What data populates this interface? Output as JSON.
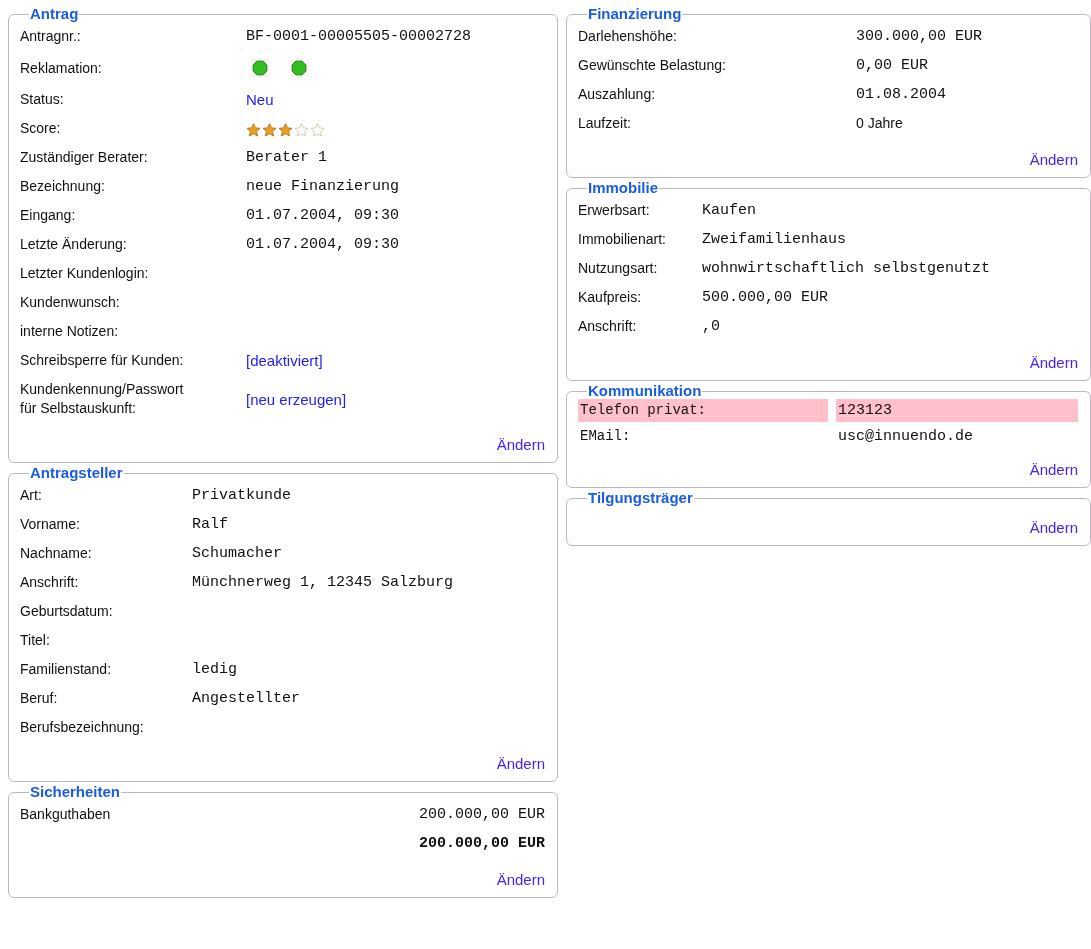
{
  "columns": [
    {
      "sections": [
        {
          "title": "Antrag",
          "kind": "grid",
          "rows": [
            {
              "label": "Antragnr.:",
              "kind": "mono",
              "value": "BF-0001-00005505-00002728"
            },
            {
              "label": "Reklamation:",
              "kind": "dots",
              "dots": [
                {
                  "color": "#33bb22"
                },
                {
                  "color": "#33bb22"
                }
              ]
            },
            {
              "label": "Status:",
              "kind": "link",
              "value": "Neu"
            },
            {
              "label": "Score:",
              "kind": "stars",
              "stars": 3
            },
            {
              "label": "Zuständiger Berater:",
              "kind": "mono",
              "value": "Berater 1"
            },
            {
              "label": "Bezeichnung:",
              "kind": "mono",
              "value": "neue Finanzierung"
            },
            {
              "label": "Eingang:",
              "kind": "mono",
              "value": "01.07.2004, 09:30"
            },
            {
              "label": "Letzte Änderung:",
              "kind": "mono",
              "value": "01.07.2004, 09:30"
            },
            {
              "label": "Letzter Kundenlogin:",
              "kind": "empty"
            },
            {
              "label": "Kundenwunsch:",
              "kind": "empty"
            },
            {
              "label": "interne Notizen:",
              "kind": "empty"
            },
            {
              "label": "Schreibsperre für Kunden:",
              "kind": "link",
              "value": "[deaktiviert]"
            },
            {
              "label": "Kundenkennung/Passwort für Selbstauskunft:",
              "kind": "link",
              "value": "[neu erzeugen]"
            }
          ],
          "action": "Ändern"
        },
        {
          "title": "Antragsteller",
          "kind": "grid",
          "rows": [
            {
              "label": "Art:",
              "kind": "mono",
              "value": "Privatkunde"
            },
            {
              "label": "Vorname:",
              "kind": "mono",
              "value": "Ralf"
            },
            {
              "label": "Nachname:",
              "kind": "mono",
              "value": "Schumacher"
            },
            {
              "label": "Anschrift:",
              "kind": "mono",
              "value": "Münchnerweg 1, 12345 Salzburg"
            },
            {
              "label": "Geburtsdatum:",
              "kind": "empty"
            },
            {
              "label": "Titel:",
              "kind": "empty"
            },
            {
              "label": "Familienstand:",
              "kind": "mono",
              "value": "ledig"
            },
            {
              "label": "Beruf:",
              "kind": "mono",
              "value": "Angestellter"
            },
            {
              "label": "Berufsbezeichnung:",
              "kind": "empty"
            }
          ],
          "action": "Ändern"
        },
        {
          "title": "Sicherheiten",
          "kind": "sum",
          "rows": [
            {
              "label": "Bankguthaben",
              "kind": "mono",
              "value": "200.000,00 EUR"
            },
            {
              "kind": "total",
              "value": "200.000,00 EUR"
            }
          ],
          "action": "Ändern"
        }
      ]
    },
    {
      "sections": [
        {
          "title": "Finanzierung",
          "kind": "grid",
          "rows": [
            {
              "label": "Darlehenshöhe:",
              "kind": "mono",
              "value": "300.000,00 EUR"
            },
            {
              "label": "Gewünschte Belastung:",
              "kind": "mono",
              "value": "0,00 EUR"
            },
            {
              "label": "Auszahlung:",
              "kind": "mono",
              "value": "01.08.2004"
            },
            {
              "label": "Laufzeit:",
              "kind": "text",
              "value": "0 Jahre"
            }
          ],
          "action": "Ändern"
        },
        {
          "title": "Immobilie",
          "kind": "grid",
          "rows": [
            {
              "label": "Erwerbsart:",
              "kind": "mono",
              "value": "Kaufen"
            },
            {
              "label": "Immobilienart:",
              "kind": "mono",
              "value": "Zweifamilienhaus"
            },
            {
              "label": "Nutzungsart:",
              "kind": "mono",
              "value": "wohnwirtschaftlich selbstgenutzt"
            },
            {
              "label": "Kaufpreis:",
              "kind": "mono",
              "value": "500.000,00 EUR"
            },
            {
              "label": "Anschrift:",
              "kind": "mono",
              "value": ",0"
            }
          ],
          "action": "Ändern"
        },
        {
          "title": "Kommunikation",
          "kind": "table",
          "rows": [
            {
              "label": "Telefon privat:",
              "kind": "mono",
              "value": "123123",
              "highlighted": true
            },
            {
              "label": "EMail:",
              "kind": "mono",
              "value": "usc@innuendo.de",
              "highlighted": false
            }
          ],
          "action": "Ändern"
        },
        {
          "title": "Tilgungsträger",
          "action": "Ändern"
        }
      ]
    }
  ]
}
